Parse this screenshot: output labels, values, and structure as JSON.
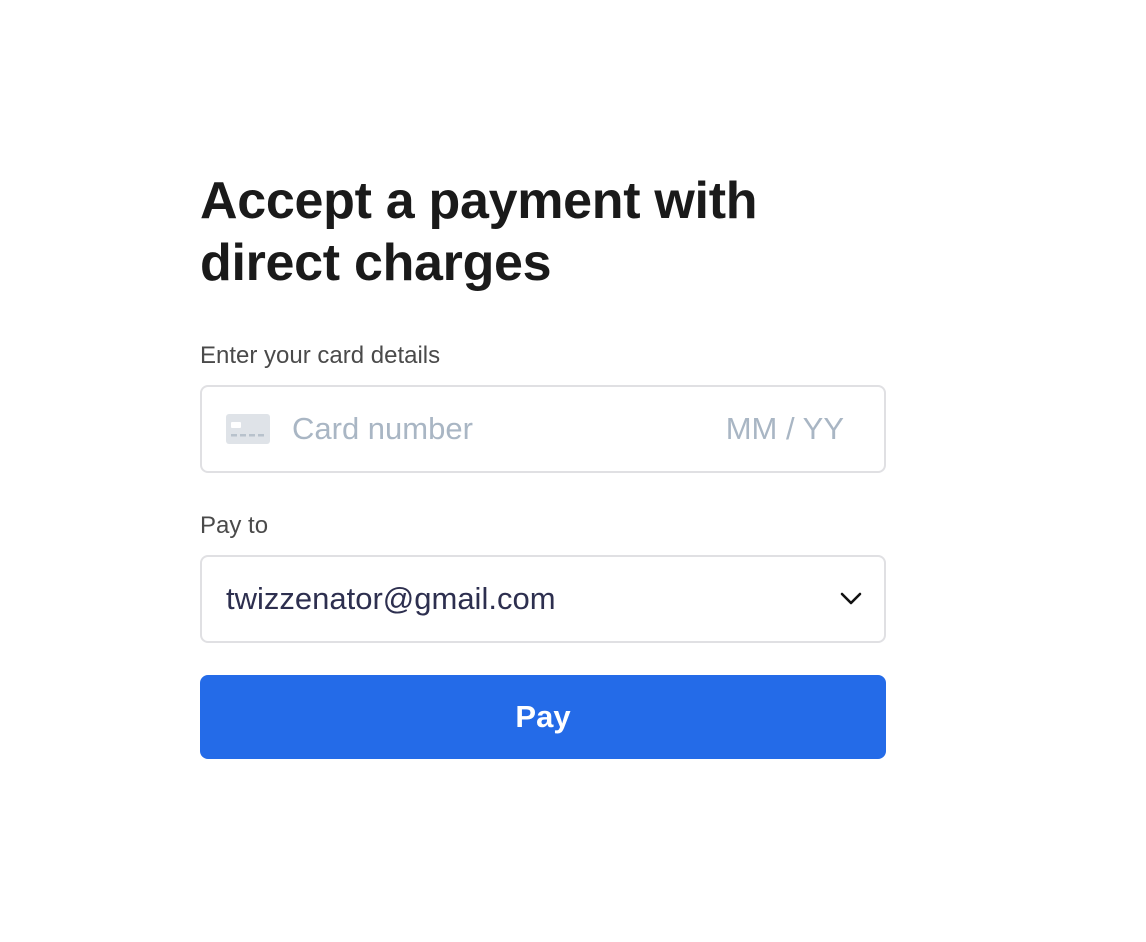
{
  "page": {
    "title": "Accept a payment with direct charges"
  },
  "card_section": {
    "label": "Enter your card details",
    "card_number_placeholder": "Card number",
    "expiry_placeholder": "MM / YY",
    "card_icon": "credit-card-icon"
  },
  "pay_to": {
    "label": "Pay to",
    "selected_value": "twizzenator@gmail.com",
    "dropdown_icon": "chevron-down-icon"
  },
  "pay_button": {
    "label": "Pay"
  },
  "colors": {
    "accent": "#246be8",
    "title_text": "#1a1a1a",
    "placeholder": "#a9b6c4",
    "select_text": "#2d2f4f",
    "border": "#e0e0e3"
  }
}
